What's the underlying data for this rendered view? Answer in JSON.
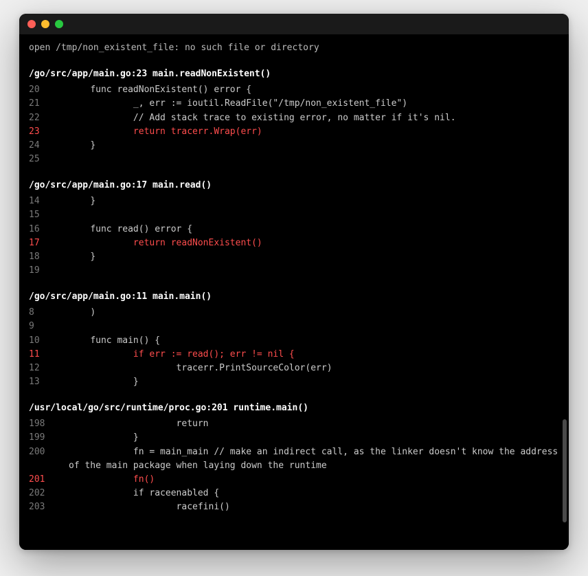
{
  "error_message": "open /tmp/non_existent_file: no such file or directory",
  "frames": [
    {
      "header": "/go/src/app/main.go:23 main.readNonExistent()",
      "lines": [
        {
          "n": "20",
          "code": "    func readNonExistent() error {",
          "hl": false
        },
        {
          "n": "21",
          "code": "            _, err := ioutil.ReadFile(\"/tmp/non_existent_file\")",
          "hl": false
        },
        {
          "n": "22",
          "code": "            // Add stack trace to existing error, no matter if it's nil.",
          "hl": false
        },
        {
          "n": "23",
          "code": "            return tracerr.Wrap(err)",
          "hl": true
        },
        {
          "n": "24",
          "code": "    }",
          "hl": false
        },
        {
          "n": "25",
          "code": "",
          "hl": false
        }
      ]
    },
    {
      "header": "/go/src/app/main.go:17 main.read()",
      "lines": [
        {
          "n": "14",
          "code": "    }",
          "hl": false
        },
        {
          "n": "15",
          "code": "",
          "hl": false
        },
        {
          "n": "16",
          "code": "    func read() error {",
          "hl": false
        },
        {
          "n": "17",
          "code": "            return readNonExistent()",
          "hl": true
        },
        {
          "n": "18",
          "code": "    }",
          "hl": false
        },
        {
          "n": "19",
          "code": "",
          "hl": false
        }
      ]
    },
    {
      "header": "/go/src/app/main.go:11 main.main()",
      "lines": [
        {
          "n": "8",
          "code": "    )",
          "hl": false
        },
        {
          "n": "9",
          "code": "",
          "hl": false
        },
        {
          "n": "10",
          "code": "    func main() {",
          "hl": false
        },
        {
          "n": "11",
          "code": "            if err := read(); err != nil {",
          "hl": true
        },
        {
          "n": "12",
          "code": "                    tracerr.PrintSourceColor(err)",
          "hl": false
        },
        {
          "n": "13",
          "code": "            }",
          "hl": false
        }
      ]
    },
    {
      "header": "/usr/local/go/src/runtime/proc.go:201 runtime.main()",
      "lines": [
        {
          "n": "198",
          "code": "                    return",
          "hl": false
        },
        {
          "n": "199",
          "code": "            }",
          "hl": false
        },
        {
          "n": "200",
          "code": "            fn = main_main // make an indirect call, as the linker doesn't know the address of the main package when laying down the runtime",
          "hl": false,
          "wrapped": true
        },
        {
          "n": "201",
          "code": "            fn()",
          "hl": true
        },
        {
          "n": "202",
          "code": "            if raceenabled {",
          "hl": false
        },
        {
          "n": "203",
          "code": "                    racefini()",
          "hl": false
        }
      ]
    }
  ]
}
